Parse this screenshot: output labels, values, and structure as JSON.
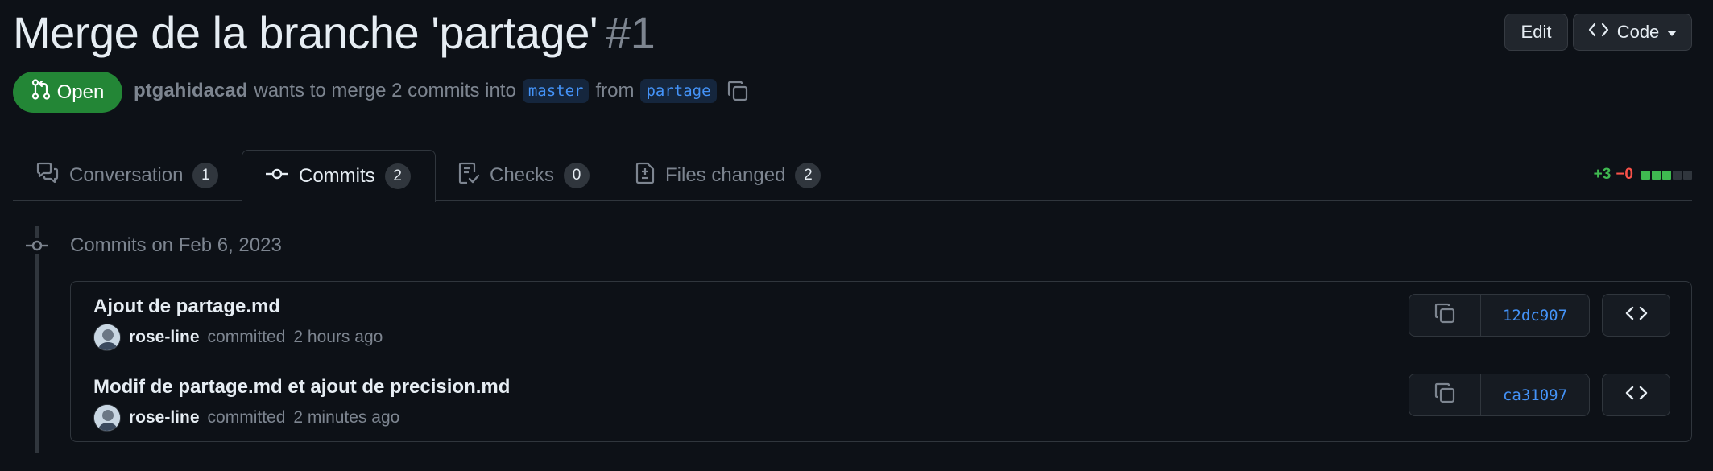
{
  "pr": {
    "title": "Merge de la branche 'partage'",
    "number": "#1",
    "state": "Open",
    "author": "ptgahidacad",
    "merge_text": "wants to merge 2 commits into",
    "base_branch": "master",
    "from_text": "from",
    "head_branch": "partage"
  },
  "actions": {
    "edit_label": "Edit",
    "code_label": "Code"
  },
  "tabs": [
    {
      "label": "Conversation",
      "count": "1",
      "icon": "comment-discussion-icon"
    },
    {
      "label": "Commits",
      "count": "2",
      "icon": "git-commit-icon"
    },
    {
      "label": "Checks",
      "count": "0",
      "icon": "checklist-icon"
    },
    {
      "label": "Files changed",
      "count": "2",
      "icon": "file-diff-icon"
    }
  ],
  "active_tab": "Commits",
  "diffstat": {
    "additions": "+3",
    "deletions": "−0",
    "blocks": [
      "added",
      "added",
      "added",
      "neutral",
      "neutral"
    ]
  },
  "commit_group": {
    "header": "Commits on Feb 6, 2023"
  },
  "commits": [
    {
      "title": "Ajout de partage.md",
      "author": "rose-line",
      "action": "committed",
      "time": "2 hours ago",
      "sha": "12dc907"
    },
    {
      "title": "Modif de partage.md et ajout de precision.md",
      "author": "rose-line",
      "action": "committed",
      "time": "2 minutes ago",
      "sha": "ca31097"
    }
  ],
  "colors": {
    "background": "#0d1117",
    "open_green": "#238636",
    "link_blue": "#4493f8",
    "addition_green": "#3fb950",
    "deletion_red": "#f85149",
    "muted": "#7d8590",
    "border": "#30363d"
  }
}
